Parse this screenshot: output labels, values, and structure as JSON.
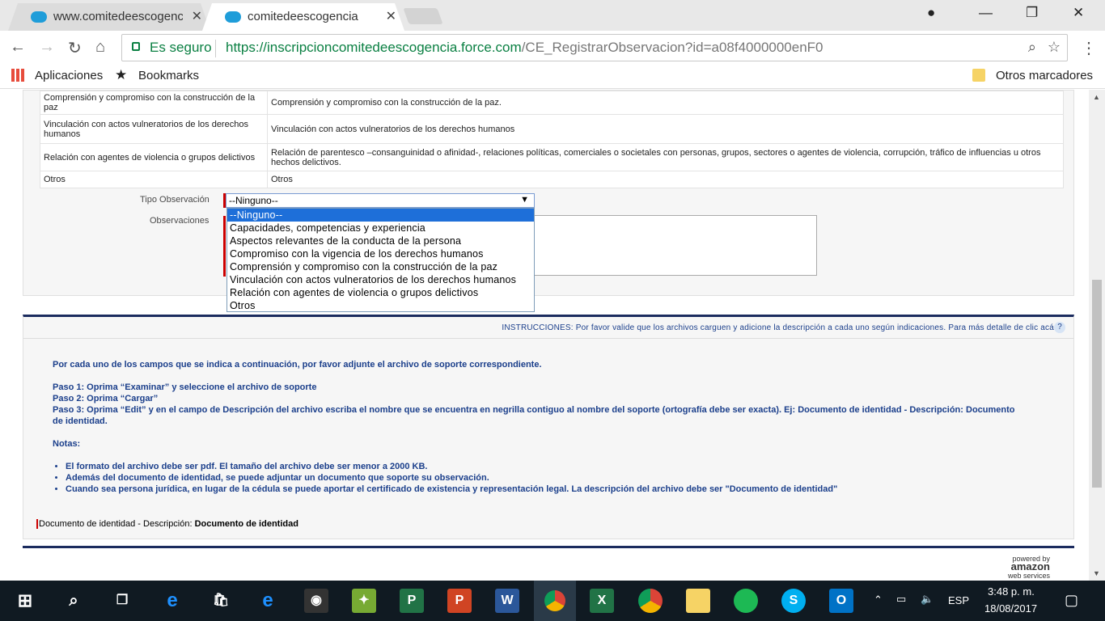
{
  "browser": {
    "tab1_title": "www.comitedeescogencia",
    "tab2_title": "comitedeescogencia",
    "secure_label": "Es seguro",
    "url_host": "https://inscripcioncomitedeescogencia.force.com",
    "url_path": "/CE_RegistrarObservacion?id=a08f4000000enF0"
  },
  "bookmarks": {
    "apps": "Aplicaciones",
    "bookmarks": "Bookmarks",
    "other": "Otros marcadores"
  },
  "table": {
    "rows": [
      {
        "name": "Comprensión y compromiso con la construcción de la paz",
        "desc": "Comprensión y compromiso con la construcción de la paz."
      },
      {
        "name": "Vinculación con actos vulneratorios de los derechos humanos",
        "desc": "Vinculación con actos vulneratorios de los derechos humanos"
      },
      {
        "name": "Relación con agentes de violencia o grupos delictivos",
        "desc": "Relación de parentesco –consanguinidad o afinidad-, relaciones políticas, comerciales o societales con personas, grupos, sectores o agentes de violencia, corrupción, tráfico de influencias u otros hechos delictivos."
      },
      {
        "name": "Otros",
        "desc": "Otros"
      }
    ]
  },
  "form": {
    "tipo_label": "Tipo Observación",
    "obs_label": "Observaciones",
    "selected": "--Ninguno--",
    "options": [
      "--Ninguno--",
      "Capacidades, competencias y experiencia",
      "Aspectos relevantes de la conducta de la persona",
      "Compromiso con la vigencia de los derechos humanos",
      "Comprensión y compromiso con la construcción de la paz",
      "Vinculación con actos vulneratorios de los derechos humanos",
      "Relación con agentes de violencia o grupos delictivos",
      "Otros"
    ]
  },
  "instructions": {
    "header": "INSTRUCCIONES: Por favor valide que los archivos carguen y adicione la descripción a cada uno según indicaciones. Para más detalle de clic acá",
    "intro": "Por cada uno de los campos que se indica a continuación, por favor adjunte el archivo de soporte correspondiente.",
    "paso1": "Paso 1: Oprima “Examinar” y seleccione el archivo de soporte",
    "paso2": "Paso 2: Oprima “Cargar”",
    "paso3": "Paso 3: Oprima “Edit” y en el campo de Descripción del archivo escriba el nombre que se encuentra en negrilla contiguo al nombre del soporte (ortografía debe ser exacta). Ej: Documento de identidad - Descripción: Documento de identidad.",
    "notas": "Notas:",
    "notes": [
      "El formato del archivo debe ser pdf. El tamaño del archivo debe ser menor a 2000 KB.",
      "Además del documento de identidad, se puede adjuntar un documento que soporte su observación.",
      "Cuando sea persona jurídica, en lugar de la cédula se puede aportar el certificado de existencia y representación legal. La descripción del archivo debe ser \"Documento de identidad\""
    ],
    "doc_prefix": "Documento de identidad - Descripción: ",
    "doc_bold": "Documento de identidad"
  },
  "aws": {
    "line1": "powered by",
    "line2": "amazon",
    "line3": "web services"
  },
  "taskbar": {
    "lang": "ESP",
    "time": "3:48 p. m.",
    "date": "18/08/2017"
  }
}
